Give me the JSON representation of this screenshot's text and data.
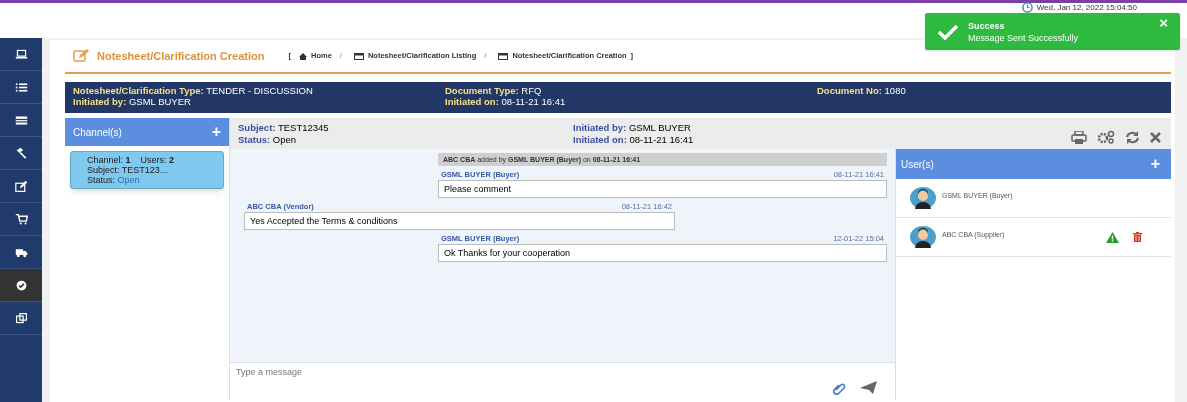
{
  "header": {
    "clock": "Wed, Jan 12, 2022 15:04:50"
  },
  "sidebar": {
    "items": [
      {
        "selected": false
      },
      {
        "selected": false
      },
      {
        "selected": false
      },
      {
        "selected": false
      },
      {
        "selected": false
      },
      {
        "selected": false
      },
      {
        "selected": false
      },
      {
        "selected": true
      },
      {
        "selected": false
      }
    ]
  },
  "page": {
    "title": "Notesheet/Clarification Creation",
    "breadcrumb": {
      "open": "[",
      "separator": "/",
      "items": [
        "Home",
        "Notesheet/Clarification Listing",
        "Notesheet/Clarification Creation"
      ],
      "close": "]"
    }
  },
  "info_bar": [
    {
      "label": "Notesheet/Clarification Type:",
      "value": "TENDER - DISCUSSION"
    },
    {
      "label": "Initiated by:",
      "value": "GSML BUYER"
    },
    {
      "label": "Document Type:",
      "value": "RFQ"
    },
    {
      "label": "Initiated on:",
      "value": "08-11-21 16:41"
    },
    {
      "label": "Document No:",
      "value": "1080"
    }
  ],
  "channels": {
    "title": "Channel(s)",
    "add": "+",
    "items": [
      {
        "channel_label": "Channel:",
        "channel": "1",
        "users_label": "Users:",
        "users": "2",
        "subject_label": "Subject:",
        "subject": "TEST123...",
        "status_label": "Status:",
        "status": "Open",
        "selected": true
      }
    ]
  },
  "chat": {
    "subject_label": "Subject:",
    "subject": "TEST12345",
    "status_label": "Status:",
    "status": "Open",
    "initiated_by_label": "Initiated by:",
    "initiated_by": "GSML BUYER",
    "initiated_on_label": "Initiated on:",
    "initiated_on": "08-11-21 16:41",
    "messages": [
      {
        "kind": "system",
        "text": "**ABC CBA** added by **GSML BUYER (Buyer)** on **08-11-21 16:41**"
      },
      {
        "kind": "outgoing",
        "sender": "GSML BUYER (Buyer)",
        "time": "08-11-21 16:41",
        "text": "Please comment"
      },
      {
        "kind": "incoming",
        "sender": "ABC CBA (Vendor)",
        "time": "08-11-21 16:42",
        "text": "Yes Accepted the Terms & conditions"
      },
      {
        "kind": "outgoing",
        "sender": "GSML BUYER (Buyer)",
        "time": "12-01-22 15:04",
        "text": "Ok Thanks for your cooperation"
      }
    ],
    "input": {
      "placeholder": "Type a message"
    }
  },
  "users": {
    "title": "User(s)",
    "add": "+",
    "items": [
      {
        "name": "GSML BUYER (Buyer)",
        "actions": false
      },
      {
        "name": "ABC CBA (Supplier)",
        "actions": true
      }
    ]
  },
  "toast": {
    "title": "Success",
    "message": "Message Sent Successfully",
    "close": "×"
  }
}
